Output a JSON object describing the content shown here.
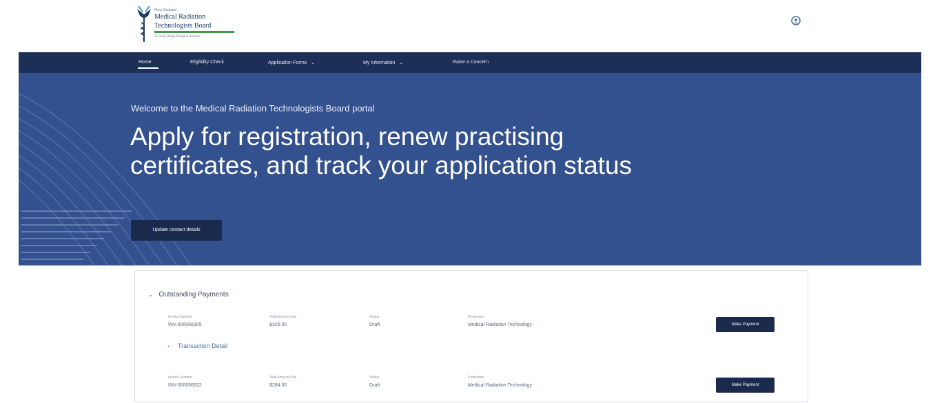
{
  "logo": {
    "line1": "New Zealand",
    "line2": "Medical Radiation",
    "line3": "Technologists Board",
    "line4": "Te Poari Ringa Hangarau Iraruke"
  },
  "nav": {
    "items": [
      {
        "label": "Home"
      },
      {
        "label": "Eligibility Check"
      },
      {
        "label": "Application Forms",
        "caret": "⌄"
      },
      {
        "label": "My Information",
        "caret": "⌄"
      },
      {
        "label": "Raise a Concern"
      }
    ]
  },
  "hero": {
    "welcome": "Welcome to the Medical Radiation Technologists Board portal",
    "heading": "Apply for registration, renew practising certificates, and track your application status",
    "button": "Update contact details"
  },
  "payments": {
    "title": "Outstanding Payments",
    "columns": [
      "Invoice Number",
      "Total Amount Due",
      "Status",
      "Profession"
    ],
    "pay_label": "Make Payment",
    "transaction_label": "Transaction Detail",
    "rows": [
      {
        "invoice": "INV-000056305",
        "amount": "$325.00",
        "status": "Draft",
        "profession": "Medical Radiation Technology"
      },
      {
        "invoice": "INV-000056522",
        "amount": "$284.00",
        "status": "Draft",
        "profession": "Medical Radiation Technology"
      }
    ]
  },
  "colors": {
    "navbar": "#1c2f57",
    "hero": "#33518f",
    "button": "#1a2a4d",
    "logo_green": "#3f9a4a"
  },
  "icons": {
    "user": "user-profile-icon",
    "chevron": "chevron-down-icon",
    "transaction_toggle": "chevron-right-icon"
  }
}
